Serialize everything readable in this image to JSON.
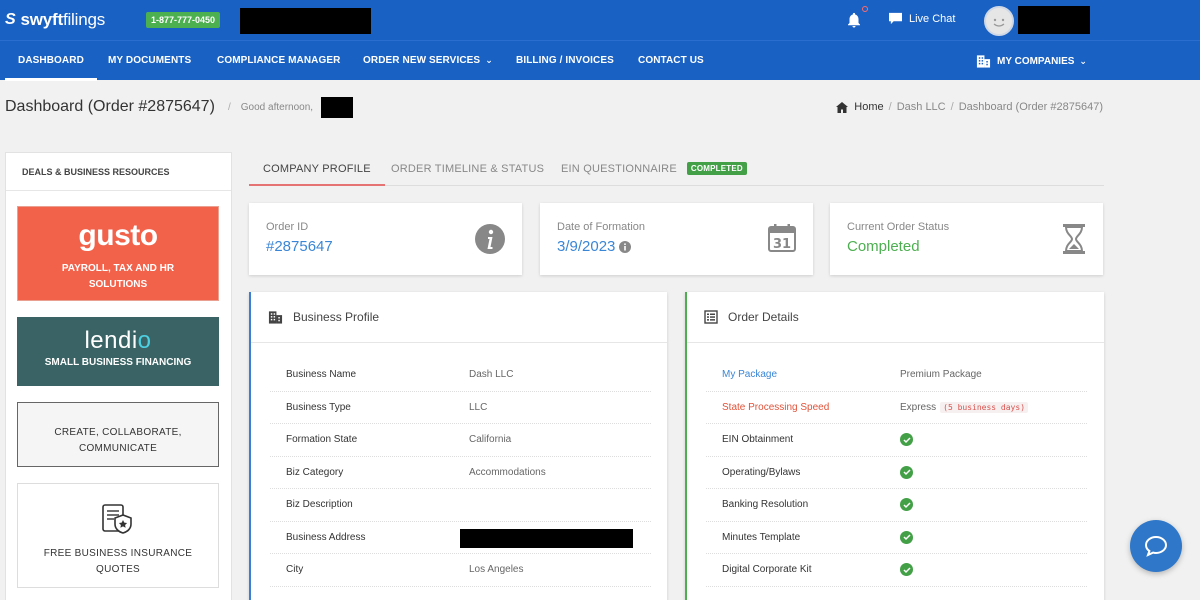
{
  "topbar": {
    "logo_mark": "S",
    "logo_text_1": "swyft",
    "logo_text_2": "filings",
    "phone": "1-877-777-0450",
    "live_chat": "Live Chat"
  },
  "nav": {
    "items": [
      {
        "label": "DASHBOARD"
      },
      {
        "label": "MY DOCUMENTS"
      },
      {
        "label": "COMPLIANCE MANAGER"
      },
      {
        "label": "ORDER NEW SERVICES"
      },
      {
        "label": "BILLING / INVOICES"
      },
      {
        "label": "CONTACT US"
      }
    ],
    "my_companies": "MY COMPANIES"
  },
  "header": {
    "title": "Dashboard (Order #2875647)",
    "greeting": "Good afternoon,",
    "breadcrumb": [
      "Home",
      "Dash LLC",
      "Dashboard (Order #2875647)"
    ]
  },
  "sidebar": {
    "title": "DEALS & BUSINESS RESOURCES",
    "gusto_brand": "gusto",
    "gusto_desc_1": "PAYROLL, TAX AND HR",
    "gusto_desc_2": "SOLUTIONS",
    "lendio_brand_1": "lendi",
    "lendio_brand_2": "o",
    "lendio_desc": "SMALL BUSINESS FINANCING",
    "collab_desc_1": "CREATE, COLLABORATE,",
    "collab_desc_2": "COMMUNICATE",
    "insure_desc_1": "FREE BUSINESS INSURANCE",
    "insure_desc_2": "QUOTES"
  },
  "tabs": {
    "profile": "COMPANY PROFILE",
    "timeline": "ORDER TIMELINE & STATUS",
    "ein": "EIN QUESTIONNAIRE",
    "ein_badge": "COMPLETED"
  },
  "cards": {
    "order_id_label": "Order ID",
    "order_id": "#2875647",
    "formation_label": "Date of Formation",
    "formation_date": "3/9/2023",
    "status_label": "Current Order Status",
    "status": "Completed"
  },
  "business_profile": {
    "title": "Business Profile",
    "rows": [
      {
        "k": "Business Name",
        "v": "Dash LLC"
      },
      {
        "k": "Business Type",
        "v": "LLC"
      },
      {
        "k": "Formation State",
        "v": "California"
      },
      {
        "k": "Biz Category",
        "v": "Accommodations"
      },
      {
        "k": "Biz Description",
        "v": ""
      },
      {
        "k": "Business Address",
        "v": ""
      },
      {
        "k": "City",
        "v": "Los Angeles"
      }
    ]
  },
  "order_details": {
    "title": "Order Details",
    "package_label": "My Package",
    "package_value": "Premium Package",
    "speed_label": "State Processing Speed",
    "speed_value": "Express",
    "speed_badge": "(5 business days)",
    "rows": [
      {
        "k": "EIN Obtainment"
      },
      {
        "k": "Operating/Bylaws"
      },
      {
        "k": "Banking Resolution"
      },
      {
        "k": "Minutes Template"
      },
      {
        "k": "Digital Corporate Kit"
      }
    ]
  },
  "colors": {
    "brand_blue": "#1a61c4",
    "success_green": "#43a047",
    "gusto_orange": "#f2624b",
    "lendio_teal": "#396364"
  }
}
